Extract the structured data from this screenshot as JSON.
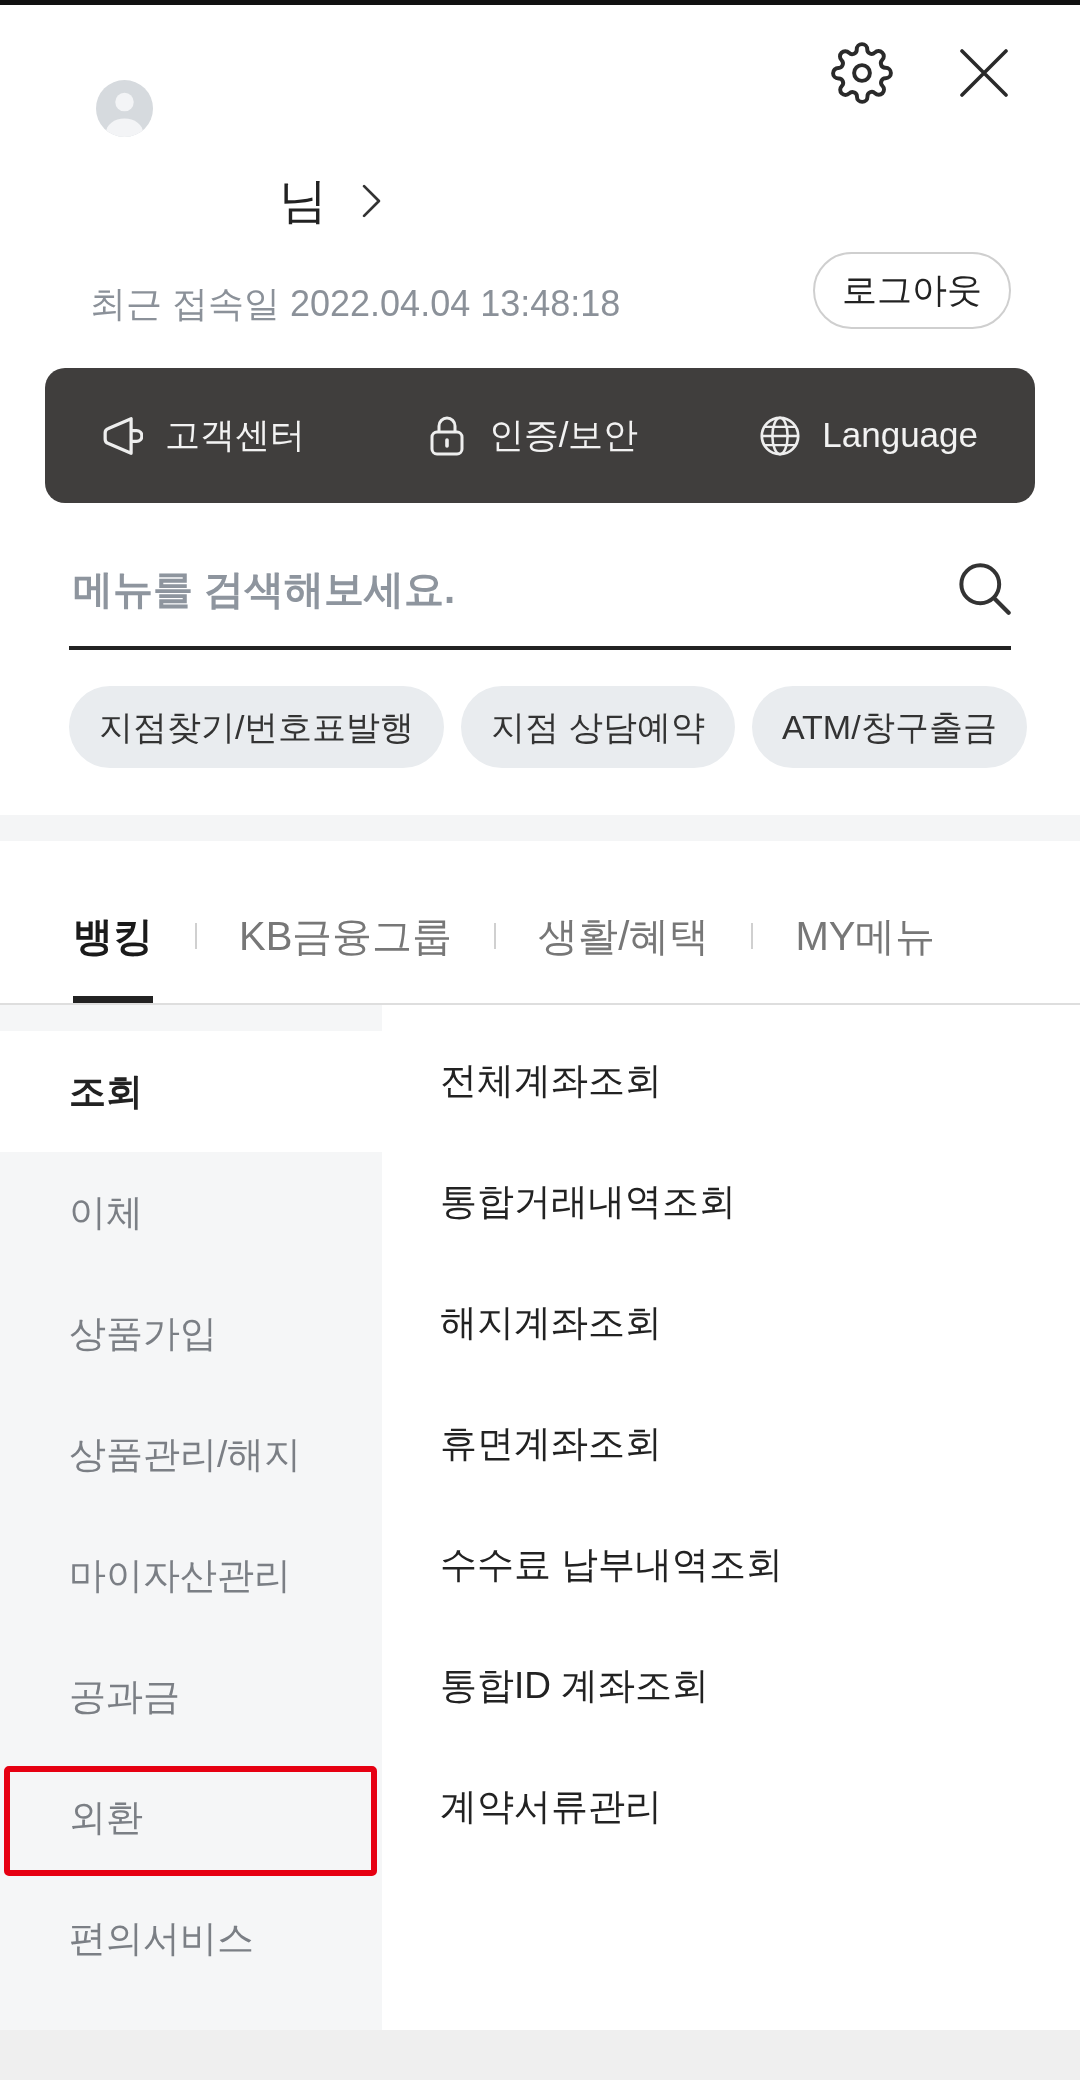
{
  "header": {
    "greeting": "님",
    "last_login": "최근 접속일 2022.04.04 13:48:18",
    "logout_button": "로그아웃"
  },
  "quick_links": [
    {
      "label": "고객센터"
    },
    {
      "label": "인증/보안"
    },
    {
      "label": "Language"
    }
  ],
  "search": {
    "placeholder": "메뉴를 검색해보세요."
  },
  "shortcuts": [
    "지점찾기/번호표발행",
    "지점 상담예약",
    "ATM/창구출금"
  ],
  "tabs": [
    {
      "label": "뱅킹",
      "selected": true
    },
    {
      "label": "KB금융그룹",
      "selected": false
    },
    {
      "label": "생활/혜택",
      "selected": false
    },
    {
      "label": "MY메뉴",
      "selected": false
    }
  ],
  "categories": [
    {
      "label": "조회",
      "selected": true,
      "highlighted": false
    },
    {
      "label": "이체",
      "selected": false,
      "highlighted": false
    },
    {
      "label": "상품가입",
      "selected": false,
      "highlighted": false
    },
    {
      "label": "상품관리/해지",
      "selected": false,
      "highlighted": false
    },
    {
      "label": "마이자산관리",
      "selected": false,
      "highlighted": false
    },
    {
      "label": "공과금",
      "selected": false,
      "highlighted": false
    },
    {
      "label": "외환",
      "selected": false,
      "highlighted": true
    },
    {
      "label": "편의서비스",
      "selected": false,
      "highlighted": false
    }
  ],
  "submenu": [
    "전체계좌조회",
    "통합거래내역조회",
    "해지계좌조회",
    "휴면계좌조회",
    "수수료 납부내역조회",
    "통합ID 계좌조회",
    "계약서류관리"
  ]
}
